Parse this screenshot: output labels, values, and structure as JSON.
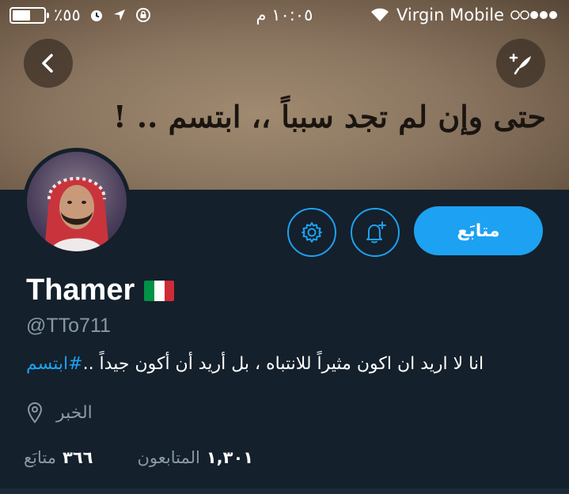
{
  "status_bar": {
    "battery_percent": "٪٥٥",
    "time": "١٠:٠٥ م",
    "carrier": "Virgin Mobile"
  },
  "header": {
    "banner_text": "حتى وإن لم تجد سبباً ،، ابتسم .. !",
    "back_icon": "chevron-left-icon",
    "compose_icon": "compose-tweet-icon"
  },
  "profile": {
    "name": "Thamer",
    "flag": "italy-flag",
    "handle": "@TTo711",
    "bio_text": "انا لا اريد ان اكون مثيراً للانتباه ، بل أريد أن أكون جيداً ..",
    "bio_hashtag": "#ابتسم",
    "location": "الخبر",
    "follow_label": "متابَع",
    "following_count": "٣٦٦",
    "following_label": "متابَع",
    "followers_count": "١,٣٠١",
    "followers_label": "المتابعون"
  },
  "colors": {
    "accent": "#1da1f2",
    "background": "#14202b",
    "muted": "#8899a6"
  }
}
